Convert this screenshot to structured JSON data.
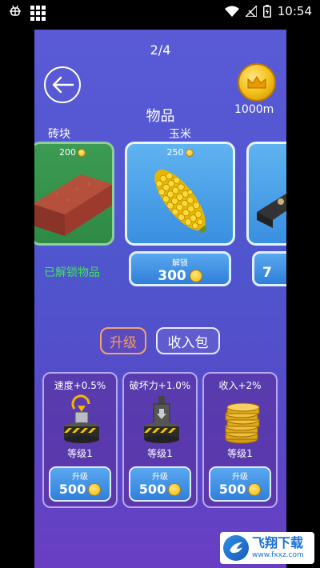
{
  "status_bar": {
    "time": "10:54",
    "app_icon": "bug-icon"
  },
  "game": {
    "pager": "2/4",
    "distance": "1000m",
    "section_title": "物品",
    "items": [
      {
        "name": "砖块",
        "price": "200",
        "status": "已解锁物品"
      },
      {
        "name": "玉米",
        "price": "250",
        "unlock_label": "解锁",
        "unlock_cost": "300"
      },
      {
        "name": "",
        "unlock_cost": "7"
      }
    ],
    "tabs": {
      "upgrade": "升级",
      "income": "收入包"
    },
    "upgrades": [
      {
        "title": "速度+0.5%",
        "level": "等级1",
        "button_label": "升级",
        "cost": "500"
      },
      {
        "title": "破坏力+1.0%",
        "level": "等级1",
        "button_label": "升级",
        "cost": "500"
      },
      {
        "title": "收入+2%",
        "level": "等级1",
        "button_label": "升级",
        "cost": "500"
      }
    ]
  },
  "watermark": {
    "title": "飞翔下载",
    "url": "www.fxxz.com"
  },
  "colors": {
    "accent": "#f39a63",
    "unlocked": "#3fe05a",
    "button": "#2f7fd9"
  }
}
